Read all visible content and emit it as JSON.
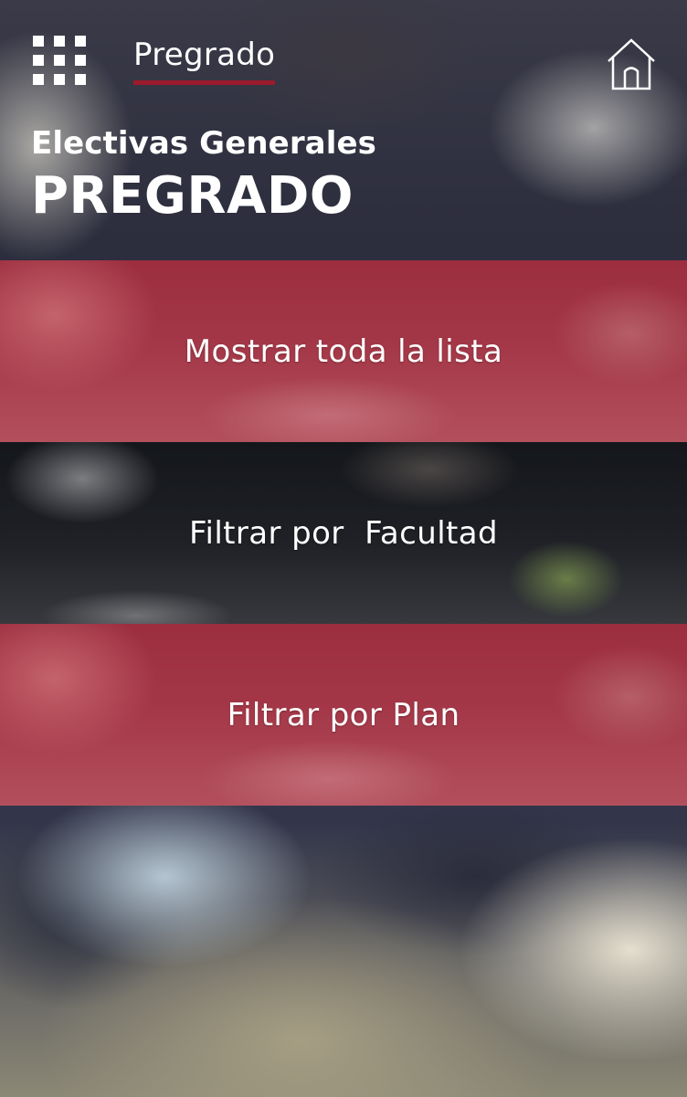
{
  "header": {
    "menu_icon": "grid-menu-icon",
    "tab_label": "Pregrado",
    "home_icon": "home-icon",
    "subtitle": "Electivas Generales",
    "title": "PREGRADO"
  },
  "options": [
    {
      "label": "Mostrar toda la lista",
      "style": "red"
    },
    {
      "label": "Filtrar por  Facultad",
      "style": "dark"
    },
    {
      "label": "Filtrar por Plan",
      "style": "red"
    }
  ],
  "colors": {
    "accent": "#9b1a2c",
    "text": "#ffffff",
    "red_overlay": "#a53c4c",
    "dark_overlay": "#1b1e24"
  }
}
